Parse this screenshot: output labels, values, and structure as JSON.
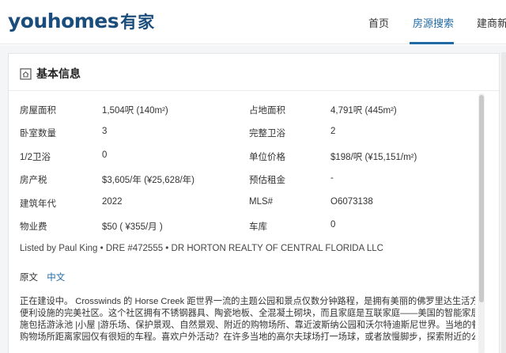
{
  "brand": {
    "logo_latin": "youhomes",
    "logo_cn": "有家"
  },
  "nav": {
    "items": [
      {
        "label": "首页"
      },
      {
        "label": "房源搜索"
      },
      {
        "label": "建商新盘"
      }
    ],
    "active_index": 1
  },
  "section": {
    "title": "基本信息"
  },
  "facts": [
    {
      "label": "房屋面积",
      "value": "1,504呎 (140m²)",
      "label2": "占地面积",
      "value2": "4,791呎 (445m²)"
    },
    {
      "label": "卧室数量",
      "value": "3",
      "label2": "完整卫浴",
      "value2": "2"
    },
    {
      "label": "1/2卫浴",
      "value": "0",
      "label2": "单位价格",
      "value2": "$198/呎 (¥15,151/m²)"
    },
    {
      "label": "房产税",
      "value": "$3,605/年 (¥25,628/年)",
      "label2": "预估租金",
      "value2": "-"
    },
    {
      "label": "建筑年代",
      "value": "2022",
      "label2": "MLS#",
      "value2": "O6073138"
    },
    {
      "label": "物业费",
      "value": "$50 ( ¥355/月 )",
      "label2": "车库",
      "value2": "0"
    }
  ],
  "listed_by": "Listed by Paul King • DRE #472555 • DR HORTON REALTY OF CENTRAL FLORIDA LLC",
  "language": {
    "original": "原文",
    "chinese": "中文"
  },
  "description_lines": [
    "正在建设中。 Crosswinds 的 Horse Creek 距世界一流的主题公园和景点仅数分钟路程，是拥有美丽的佛罗里达生活方式和",
    "便利设施的完美社区。这个社区拥有不锈钢器具、陶瓷地板、全混凝土砌块，而且家庭是互联家庭——美国的智能家居。设",
    "施包括游泳池 |小屋 |游乐场、保护景观、自然景观、附近的购物场所、靠近波斯纳公园和沃尔特迪斯尼世界。当地的餐馆和",
    "购物场所距离家园仅有很短的车程。喜欢户外活动？在许多当地的高尔夫球场打一场球，或者放慢脚步，探索附近的公园和"
  ],
  "colors": {
    "brand": "#1a4d7c",
    "accent": "#1f6aa5"
  }
}
